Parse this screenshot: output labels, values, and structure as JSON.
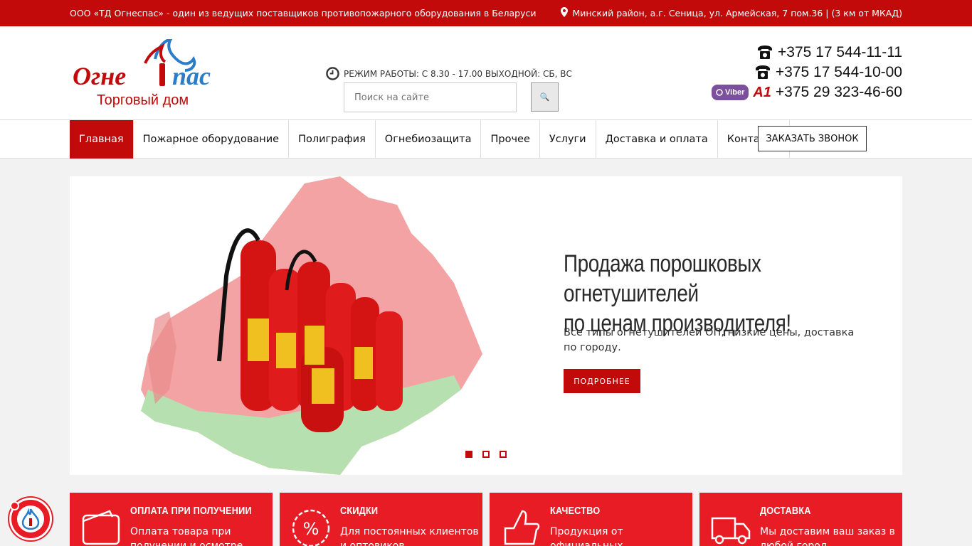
{
  "topbar": {
    "company": "ООО «ТД Огнеспас» - один из ведущих поставщиков противопожарного оборудования в Беларуси",
    "address": "Минский район, а.г. Сеница, ул. Армейская, 7 пом.36 | (3 км от МКАД)"
  },
  "logo": {
    "brand": "Огнеспас",
    "subtitle": "Торговый дом"
  },
  "header": {
    "hours": "РЕЖИМ РАБОТЫ: С 8.30 - 17.00 ВЫХОДНОЙ: СБ, ВС",
    "search_placeholder": "Поиск на сайте",
    "search_button": "🔍",
    "phones": [
      "+375 17 544-11-11",
      "+375 17 544-10-00",
      "+375 29 323-46-60"
    ],
    "viber_label": "Viber",
    "a1_label": "A1"
  },
  "nav": {
    "items": [
      "Главная",
      "Пожарное оборудование",
      "Полиграфия",
      "Огнебиозащита",
      "Прочее",
      "Услуги",
      "Доставка и оплата",
      "Контакты"
    ],
    "order_call": "ЗАКАЗАТЬ ЗВОНОК"
  },
  "slider": {
    "title_line1": "Продажа порошковых огнетушителей",
    "title_line2": "по ценам производителя!",
    "text": "Все типы огнетушителей ОП, низкие цены, доставка по городу.",
    "button": "ПОДРОБНЕЕ",
    "active_slide": 1,
    "slide_count": 3
  },
  "features": [
    {
      "title": "ОПЛАТА ПРИ ПОЛУЧЕНИИ",
      "text": "Оплата товара при получении и осмотре",
      "icon": "wallet-icon"
    },
    {
      "title": "СКИДКИ",
      "text": "Для постоянных клиентов и оптовиков",
      "icon": "percent-badge-icon"
    },
    {
      "title": "КАЧЕСТВО",
      "text": "Продукция от официальных поставщиков",
      "icon": "thumbs-up-icon"
    },
    {
      "title": "ДОСТАВКА",
      "text": "Мы доставим ваш заказ в любой город",
      "icon": "truck-icon"
    }
  ],
  "colors": {
    "brand_red": "#c20a0a",
    "feature_red": "#e81c24",
    "viber_purple": "#7b519d"
  }
}
